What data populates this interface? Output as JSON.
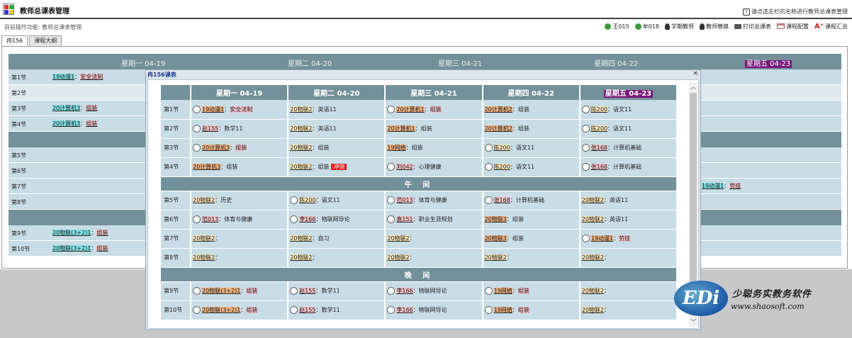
{
  "app": {
    "title": "教师总课表管理",
    "help_hint": "请点选左栏的名称进行教师总课表管理",
    "breadcrumb": "目前操作功能: 教师总课表管理"
  },
  "toolbar": [
    {
      "label": "王015",
      "icon": "add-green-icon"
    },
    {
      "label": "牟018",
      "icon": "add-green-icon"
    },
    {
      "label": "学期教师",
      "icon": "person-icon"
    },
    {
      "label": "教师替换",
      "icon": "person-icon"
    },
    {
      "label": "打印总课表",
      "icon": "printer-icon"
    },
    {
      "label": "课程配置",
      "icon": "grid-icon"
    },
    {
      "label": "课程汇总",
      "icon": "font-icon"
    }
  ],
  "tabs": [
    {
      "label": "冉156"
    },
    {
      "label": "课程大纲"
    }
  ],
  "background": {
    "days": [
      "星期一 04-19",
      "星期二 04-20",
      "星期三 04-21",
      "星期四 04-22",
      "星期五 04-23"
    ],
    "periods": [
      "第1节",
      "第2节",
      "第3节",
      "第4节",
      "第5节",
      "第6节",
      "第7节",
      "第8节",
      "第9节",
      "第10节"
    ],
    "cells": {
      "p1": {
        "cls": "19动漫1",
        "course": "安全法制"
      },
      "p3": {
        "cls": "20计算机3",
        "course": "组装"
      },
      "p4": {
        "cls": "20计算机3",
        "course": "组装"
      },
      "p7_fri": {
        "cls": "19动漫1",
        "course": "劳技"
      },
      "p9": {
        "cls": "20物联(3+2)1",
        "course": "组装"
      },
      "p10": {
        "cls": "20物联(3+2)1",
        "course": "组装"
      }
    },
    "ghost": [
      "20计算机1",
      "组装",
      "20计算机3",
      "组装"
    ]
  },
  "popup": {
    "title": "冉156课表",
    "close": "×",
    "headers": [
      "星期一 04-19",
      "星期二 04-20",
      "星期三 04-21",
      "星期四 04-22",
      "星期五 04-23"
    ],
    "noon_label": "午 间",
    "evening_label": "晚 间",
    "morning": [
      {
        "period": "第1节",
        "cells": [
          {
            "r": true,
            "cls": "19动漫1",
            "course": "安全法制",
            "h": "o"
          },
          {
            "r": false,
            "cls": "20物联2",
            "course": "英语11",
            "h": "y"
          },
          {
            "r": true,
            "cls": "20计算机1",
            "course": "组装",
            "h": "o"
          },
          {
            "r": false,
            "cls": "20计算机2",
            "course": "组装",
            "h": "o"
          },
          {
            "r": true,
            "cls": "陈200",
            "course": "语文11",
            "h": "y"
          }
        ]
      },
      {
        "period": "第2节",
        "cells": [
          {
            "r": true,
            "cls": "赵155",
            "course": "数学11",
            "h": "p"
          },
          {
            "r": false,
            "cls": "20物联2",
            "course": "英语11",
            "h": "y"
          },
          {
            "r": false,
            "cls": "20计算机1",
            "course": "组装",
            "h": "o"
          },
          {
            "r": false,
            "cls": "20计算机2",
            "course": "组装",
            "h": "o"
          },
          {
            "r": true,
            "cls": "陈200",
            "course": "语文11",
            "h": "y"
          }
        ]
      },
      {
        "period": "第3节",
        "cells": [
          {
            "r": true,
            "cls": "20计算机3",
            "course": "组装",
            "h": "o"
          },
          {
            "r": false,
            "cls": "20物联2",
            "course": "组装",
            "h": "y"
          },
          {
            "r": false,
            "cls": "19网络",
            "course": "组装",
            "h": "o"
          },
          {
            "r": true,
            "cls": "陈200",
            "course": "语文11",
            "h": "y"
          },
          {
            "r": true,
            "cls": "张168",
            "course": "计算机基础",
            "h": "p"
          }
        ]
      },
      {
        "period": "第4节",
        "cells": [
          {
            "r": false,
            "cls": "20计算机3",
            "course": "组装",
            "h": "o"
          },
          {
            "r": false,
            "cls": "20物联2",
            "course": "组装",
            "h": "y",
            "tag": "冲突"
          },
          {
            "r": true,
            "cls": "刘042",
            "course": "心理健康",
            "h": "p"
          },
          {
            "r": true,
            "cls": "陈200",
            "course": "语文11",
            "h": "y"
          },
          {
            "r": true,
            "cls": "张168",
            "course": "计算机基础",
            "h": "p"
          }
        ]
      }
    ],
    "afternoon": [
      {
        "period": "第5节",
        "cells": [
          {
            "r": false,
            "cls": "20物联2",
            "course": "历史",
            "h": "y"
          },
          {
            "r": true,
            "cls": "陈200",
            "course": "语文11",
            "h": "y"
          },
          {
            "r": true,
            "cls": "范013",
            "course": "体育与健康",
            "h": "p"
          },
          {
            "r": true,
            "cls": "张168",
            "course": "计算机基础",
            "h": "p"
          },
          {
            "r": false,
            "cls": "20物联2",
            "course": "英语11",
            "h": "y"
          }
        ]
      },
      {
        "period": "第6节",
        "cells": [
          {
            "r": true,
            "cls": "范013",
            "course": "体育与健康",
            "h": "p"
          },
          {
            "r": true,
            "cls": "李166",
            "course": "物联网导论",
            "h": "p"
          },
          {
            "r": true,
            "cls": "袁151",
            "course": "职业生涯规划",
            "h": "p"
          },
          {
            "r": false,
            "cls": "20物联3",
            "course": "组装",
            "h": "o"
          },
          {
            "r": false,
            "cls": "20物联2",
            "course": "英语11",
            "h": "y"
          }
        ]
      },
      {
        "period": "第7节",
        "cells": [
          {
            "r": false,
            "cls": "20物联2",
            "course": "",
            "h": "y"
          },
          {
            "r": false,
            "cls": "20物联2",
            "course": "自习",
            "h": "y"
          },
          {
            "r": false,
            "cls": "20物联2",
            "course": "",
            "h": "y"
          },
          {
            "r": false,
            "cls": "20物联3",
            "course": "组装",
            "h": "o"
          },
          {
            "r": true,
            "cls": "19动漫1",
            "course": "劳技",
            "h": "o"
          }
        ]
      },
      {
        "period": "第8节",
        "cells": [
          {
            "r": false,
            "cls": "20物联2",
            "course": "",
            "h": "y"
          },
          {
            "r": false,
            "cls": "20物联2",
            "course": "",
            "h": "y"
          },
          {
            "r": false,
            "cls": "20物联2",
            "course": "",
            "h": "y"
          },
          {
            "r": false,
            "cls": "20物联2",
            "course": "",
            "h": "y"
          },
          {
            "r": false,
            "cls": "20物联2",
            "course": "",
            "h": "y"
          }
        ]
      }
    ],
    "evening": [
      {
        "period": "第9节",
        "cells": [
          {
            "r": true,
            "cls": "20物联(3+2)1",
            "course": "组装",
            "h": "o"
          },
          {
            "r": true,
            "cls": "赵155",
            "course": "数学11",
            "h": "p"
          },
          {
            "r": true,
            "cls": "李166",
            "course": "物联网导论",
            "h": "p"
          },
          {
            "r": true,
            "cls": "19网络",
            "course": "组装",
            "h": "o"
          },
          {
            "r": false,
            "cls": "20物联2",
            "course": "",
            "h": "y"
          }
        ]
      },
      {
        "period": "第10节",
        "cells": [
          {
            "r": true,
            "cls": "20物联(3+2)1",
            "course": "组装",
            "h": "o"
          },
          {
            "r": true,
            "cls": "赵155",
            "course": "数学11",
            "h": "p"
          },
          {
            "r": true,
            "cls": "李166",
            "course": "物联网导论",
            "h": "p"
          },
          {
            "r": true,
            "cls": "19网络",
            "course": "组装",
            "h": "o"
          },
          {
            "r": false,
            "cls": "20物联2",
            "course": "",
            "h": "y"
          }
        ]
      }
    ]
  },
  "brand": {
    "badge": "EDi",
    "cn": "少聪务实教务软件",
    "url": "www.shaosoft.com"
  },
  "colors": {
    "header": "#74909a",
    "cell": "#c8dde6",
    "hl_orange": "#f0b27f",
    "hl_pink": "#f3c1c8",
    "hl_cyan": "#7fe1e4",
    "today": "#7a1a7a"
  }
}
